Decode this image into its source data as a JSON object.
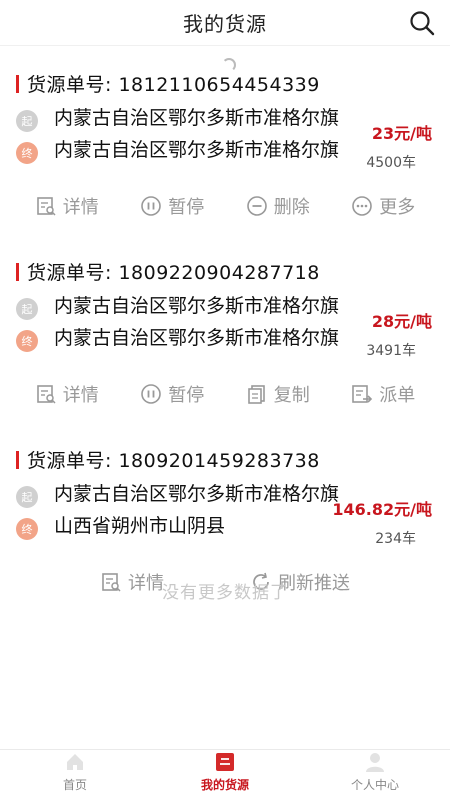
{
  "header": {
    "title": "我的货源"
  },
  "cards": [
    {
      "order_label": "货源单号: 1812110654454339",
      "start_badge": "起",
      "end_badge": "终",
      "start": "内蒙古自治区鄂尔多斯市准格尔旗",
      "end": "内蒙古自治区鄂尔多斯市准格尔旗",
      "price": "23元/吨",
      "trucks": "4500车",
      "actions": [
        "详情",
        "暂停",
        "删除",
        "更多"
      ]
    },
    {
      "order_label": "货源单号: 1809220904287718",
      "start_badge": "起",
      "end_badge": "终",
      "start": "内蒙古自治区鄂尔多斯市准格尔旗",
      "end": "内蒙古自治区鄂尔多斯市准格尔旗",
      "price": "28元/吨",
      "trucks": "3491车",
      "actions": [
        "详情",
        "暂停",
        "复制",
        "派单"
      ]
    },
    {
      "order_label": "货源单号: 1809201459283738",
      "start_badge": "起",
      "end_badge": "终",
      "start": "内蒙古自治区鄂尔多斯市准格尔旗",
      "end": "山西省朔州市山阴县",
      "price": "146.82元/吨",
      "trucks": "234车",
      "actions": [
        "详情",
        "刷新推送"
      ]
    }
  ],
  "footer_note": "没有更多数据了",
  "tabbar": {
    "items": [
      {
        "label": "首页",
        "icon": "home-icon",
        "active": false
      },
      {
        "label": "我的货源",
        "icon": "cargo-icon",
        "active": true
      },
      {
        "label": "个人中心",
        "icon": "person-icon",
        "active": false
      }
    ]
  },
  "colors": {
    "accent": "#c8161e",
    "muted": "#999999",
    "start_dot": "#d0d0d0",
    "end_dot": "#f2a488"
  }
}
